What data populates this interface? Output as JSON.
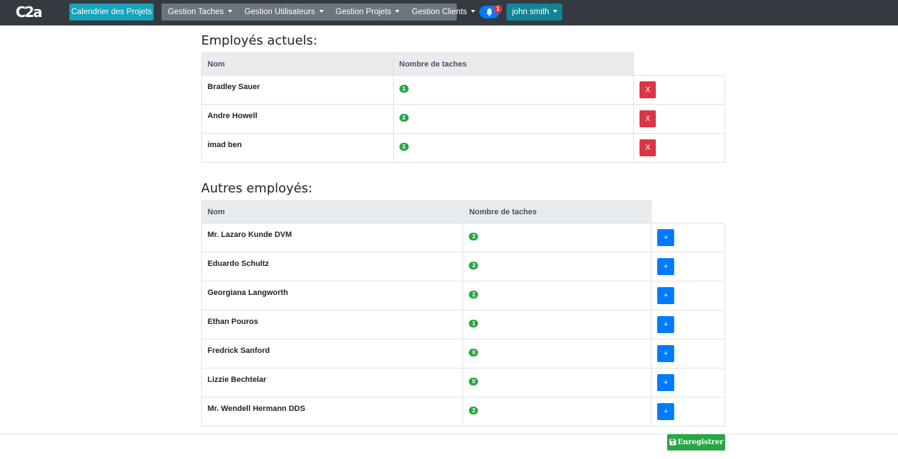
{
  "navbar": {
    "logo_text": "C2a",
    "calendar_label": "Calendrier des Projets",
    "menus": [
      "Gestion Taches",
      "Gestion Utilisateurs",
      "Gestion Projets",
      "Gestion Clients"
    ],
    "notification_count": "1",
    "user_label": "john smith",
    "icons": {
      "notification": "bell-icon",
      "dropdown": "caret-down-icon"
    }
  },
  "current_employees": {
    "title": "Employés actuels:",
    "columns": [
      "Nom",
      "Nombre de taches"
    ],
    "action_label": "X",
    "rows": [
      {
        "name": "Bradley Sauer",
        "tasks": "1"
      },
      {
        "name": "Andre Howell",
        "tasks": "3"
      },
      {
        "name": "imad ben",
        "tasks": "3"
      }
    ]
  },
  "other_employees": {
    "title": "Autres employés:",
    "columns": [
      "Nom",
      "Nombre de taches"
    ],
    "action_label": "+",
    "rows": [
      {
        "name": "Mr. Lazaro Kunde DVM",
        "tasks": "3"
      },
      {
        "name": "Eduardo Schultz",
        "tasks": "3"
      },
      {
        "name": "Georgiana Langworth",
        "tasks": "2"
      },
      {
        "name": "Ethan Pouros",
        "tasks": "1"
      },
      {
        "name": "Fredrick Sanford",
        "tasks": "0"
      },
      {
        "name": "Lizzie Bechtelar",
        "tasks": "0"
      },
      {
        "name": "Mr. Wendell Hermann DDS",
        "tasks": "2"
      }
    ]
  },
  "footer": {
    "save_label": "Enregistrer",
    "save_icon": "floppy-disk-icon"
  },
  "colors": {
    "navbar": "#343a40",
    "info": "#17a2b8",
    "secondary": "#6c757d",
    "primary": "#007bff",
    "danger": "#dc3545",
    "success": "#28a745"
  }
}
